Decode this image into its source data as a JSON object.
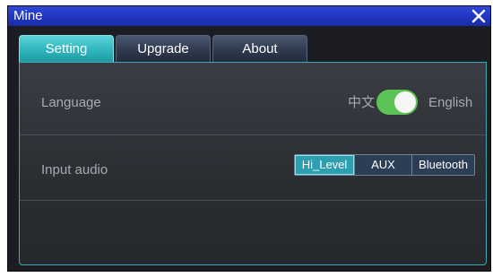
{
  "window": {
    "title": "Mine"
  },
  "tabs": [
    {
      "label": "Setting",
      "active": true
    },
    {
      "label": "Upgrade",
      "active": false
    },
    {
      "label": "About",
      "active": false
    }
  ],
  "settings": {
    "language": {
      "label": "Language",
      "option_left": "中文",
      "option_right": "English",
      "toggle_on": true
    },
    "input_audio": {
      "label": "Input audio",
      "options": [
        "Hi_Level",
        "AUX",
        "Bluetooth"
      ],
      "selected": "Hi_Level"
    }
  },
  "icons": {
    "close": "close-icon"
  },
  "colors": {
    "titlebar": "#1f35c0",
    "tab_active": "#2fb5be",
    "toggle_on": "#5cc457",
    "panel_border": "#3ba9b1"
  }
}
